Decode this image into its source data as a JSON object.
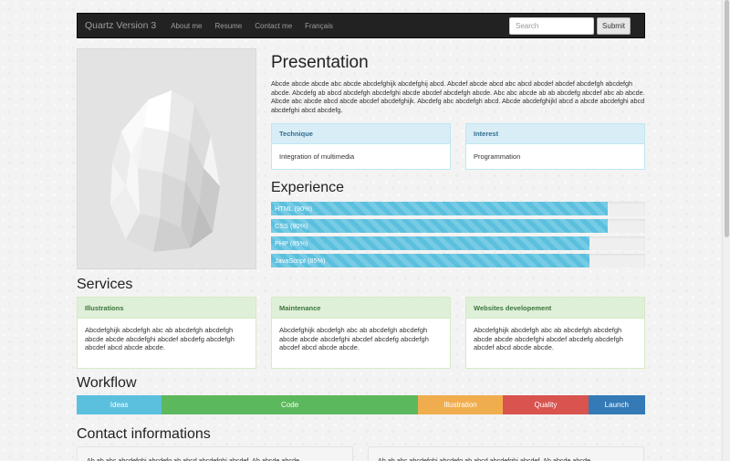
{
  "navbar": {
    "brand": "Quartz Version 3",
    "links": [
      "About me",
      "Resume",
      "Contact me",
      "Français"
    ],
    "search_placeholder": "Search",
    "submit_label": "Submit"
  },
  "presentation": {
    "title": "Presentation",
    "text": "Abcde abcde abcde abc abcde abcdefghijk abcdefghij abcd. Abcdef abcde abcd abc abcd abcdef abcdef abcdefgh abcdefgh abcde. Abcdefg ab abcd abcdefgh abcdefghi abcde abcdef abcdefgh abcde. Abc abc abcde ab ab abcdefg abcdef abc ab abcde. Abcde abc abcde abcd abcde abcdef abcdefghijk. Abcdefg abc abcdefgh abcd. Abcde abcdefghijkl abcd a abcde abcdefghi abcd abcdefghi abcd abcdefg.",
    "panels": [
      {
        "title": "Technique",
        "body": "Integration of multimedia"
      },
      {
        "title": "Interest",
        "body": "Programmation"
      }
    ]
  },
  "experience": {
    "title": "Experience",
    "skills": [
      {
        "label": "HTML (90%)",
        "percent": 90
      },
      {
        "label": "CSS (90%)",
        "percent": 90
      },
      {
        "label": "PHP (85%)",
        "percent": 85
      },
      {
        "label": "JavaScript (85%)",
        "percent": 85
      }
    ]
  },
  "services": {
    "title": "Services",
    "items": [
      {
        "title": "Illustrations",
        "body": "Abcdefghijk abcdefgh abc ab abcdefgh abcdefgh abcde abcde abcdefghi abcdef abcdefg abcdefgh abcdef abcd abcde abcde."
      },
      {
        "title": "Maintenance",
        "body": "Abcdefghijk abcdefgh abc ab abcdefgh abcdefgh abcde abcde abcdefghi abcdef abcdefg abcdefgh abcdef abcd abcde abcde."
      },
      {
        "title": "Websites developement",
        "body": "Abcdefghijk abcdefgh abc ab abcdefgh abcdefgh abcde abcde abcdefghi abcdef abcdefg abcdefgh abcdef abcd abcde abcde."
      }
    ]
  },
  "workflow": {
    "title": "Workflow",
    "steps": [
      {
        "label": "Ideas",
        "color": "#5bc0de",
        "share": 15
      },
      {
        "label": "Code",
        "color": "#5cb85c",
        "share": 45
      },
      {
        "label": "Illustration",
        "color": "#f0ad4e",
        "share": 15
      },
      {
        "label": "Quality",
        "color": "#d9534f",
        "share": 15
      },
      {
        "label": "Launch",
        "color": "#337ab7",
        "share": 10
      }
    ]
  },
  "contact": {
    "title": "Contact informations",
    "boxes": [
      "Ab ab abc abcdefghi abcdefg ab abcd abcdefghi abcdef. Ab abcde abcde",
      "Ab ab abc abcdefghi abcdefg ab abcd abcdefghi abcdef. Ab abcde abcde"
    ]
  }
}
